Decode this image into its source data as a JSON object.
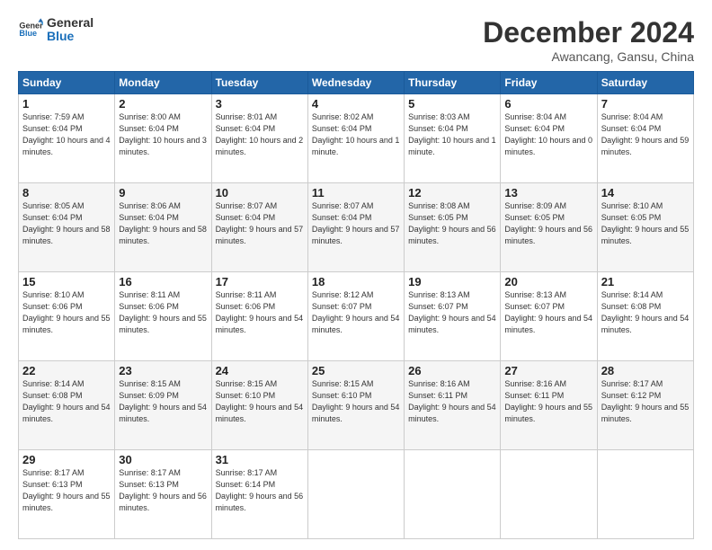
{
  "header": {
    "logo_line1": "General",
    "logo_line2": "Blue",
    "month_title": "December 2024",
    "location": "Awancang, Gansu, China"
  },
  "weekdays": [
    "Sunday",
    "Monday",
    "Tuesday",
    "Wednesday",
    "Thursday",
    "Friday",
    "Saturday"
  ],
  "weeks": [
    [
      {
        "day": "1",
        "sunrise": "7:59 AM",
        "sunset": "6:04 PM",
        "daylight": "10 hours and 4 minutes."
      },
      {
        "day": "2",
        "sunrise": "8:00 AM",
        "sunset": "6:04 PM",
        "daylight": "10 hours and 3 minutes."
      },
      {
        "day": "3",
        "sunrise": "8:01 AM",
        "sunset": "6:04 PM",
        "daylight": "10 hours and 2 minutes."
      },
      {
        "day": "4",
        "sunrise": "8:02 AM",
        "sunset": "6:04 PM",
        "daylight": "10 hours and 1 minute."
      },
      {
        "day": "5",
        "sunrise": "8:03 AM",
        "sunset": "6:04 PM",
        "daylight": "10 hours and 1 minute."
      },
      {
        "day": "6",
        "sunrise": "8:04 AM",
        "sunset": "6:04 PM",
        "daylight": "10 hours and 0 minutes."
      },
      {
        "day": "7",
        "sunrise": "8:04 AM",
        "sunset": "6:04 PM",
        "daylight": "9 hours and 59 minutes."
      }
    ],
    [
      {
        "day": "8",
        "sunrise": "8:05 AM",
        "sunset": "6:04 PM",
        "daylight": "9 hours and 58 minutes."
      },
      {
        "day": "9",
        "sunrise": "8:06 AM",
        "sunset": "6:04 PM",
        "daylight": "9 hours and 58 minutes."
      },
      {
        "day": "10",
        "sunrise": "8:07 AM",
        "sunset": "6:04 PM",
        "daylight": "9 hours and 57 minutes."
      },
      {
        "day": "11",
        "sunrise": "8:07 AM",
        "sunset": "6:04 PM",
        "daylight": "9 hours and 57 minutes."
      },
      {
        "day": "12",
        "sunrise": "8:08 AM",
        "sunset": "6:05 PM",
        "daylight": "9 hours and 56 minutes."
      },
      {
        "day": "13",
        "sunrise": "8:09 AM",
        "sunset": "6:05 PM",
        "daylight": "9 hours and 56 minutes."
      },
      {
        "day": "14",
        "sunrise": "8:10 AM",
        "sunset": "6:05 PM",
        "daylight": "9 hours and 55 minutes."
      }
    ],
    [
      {
        "day": "15",
        "sunrise": "8:10 AM",
        "sunset": "6:06 PM",
        "daylight": "9 hours and 55 minutes."
      },
      {
        "day": "16",
        "sunrise": "8:11 AM",
        "sunset": "6:06 PM",
        "daylight": "9 hours and 55 minutes."
      },
      {
        "day": "17",
        "sunrise": "8:11 AM",
        "sunset": "6:06 PM",
        "daylight": "9 hours and 54 minutes."
      },
      {
        "day": "18",
        "sunrise": "8:12 AM",
        "sunset": "6:07 PM",
        "daylight": "9 hours and 54 minutes."
      },
      {
        "day": "19",
        "sunrise": "8:13 AM",
        "sunset": "6:07 PM",
        "daylight": "9 hours and 54 minutes."
      },
      {
        "day": "20",
        "sunrise": "8:13 AM",
        "sunset": "6:07 PM",
        "daylight": "9 hours and 54 minutes."
      },
      {
        "day": "21",
        "sunrise": "8:14 AM",
        "sunset": "6:08 PM",
        "daylight": "9 hours and 54 minutes."
      }
    ],
    [
      {
        "day": "22",
        "sunrise": "8:14 AM",
        "sunset": "6:08 PM",
        "daylight": "9 hours and 54 minutes."
      },
      {
        "day": "23",
        "sunrise": "8:15 AM",
        "sunset": "6:09 PM",
        "daylight": "9 hours and 54 minutes."
      },
      {
        "day": "24",
        "sunrise": "8:15 AM",
        "sunset": "6:10 PM",
        "daylight": "9 hours and 54 minutes."
      },
      {
        "day": "25",
        "sunrise": "8:15 AM",
        "sunset": "6:10 PM",
        "daylight": "9 hours and 54 minutes."
      },
      {
        "day": "26",
        "sunrise": "8:16 AM",
        "sunset": "6:11 PM",
        "daylight": "9 hours and 54 minutes."
      },
      {
        "day": "27",
        "sunrise": "8:16 AM",
        "sunset": "6:11 PM",
        "daylight": "9 hours and 55 minutes."
      },
      {
        "day": "28",
        "sunrise": "8:17 AM",
        "sunset": "6:12 PM",
        "daylight": "9 hours and 55 minutes."
      }
    ],
    [
      {
        "day": "29",
        "sunrise": "8:17 AM",
        "sunset": "6:13 PM",
        "daylight": "9 hours and 55 minutes."
      },
      {
        "day": "30",
        "sunrise": "8:17 AM",
        "sunset": "6:13 PM",
        "daylight": "9 hours and 56 minutes."
      },
      {
        "day": "31",
        "sunrise": "8:17 AM",
        "sunset": "6:14 PM",
        "daylight": "9 hours and 56 minutes."
      },
      null,
      null,
      null,
      null
    ]
  ],
  "labels": {
    "sunrise": "Sunrise:",
    "sunset": "Sunset:",
    "daylight": "Daylight:"
  }
}
